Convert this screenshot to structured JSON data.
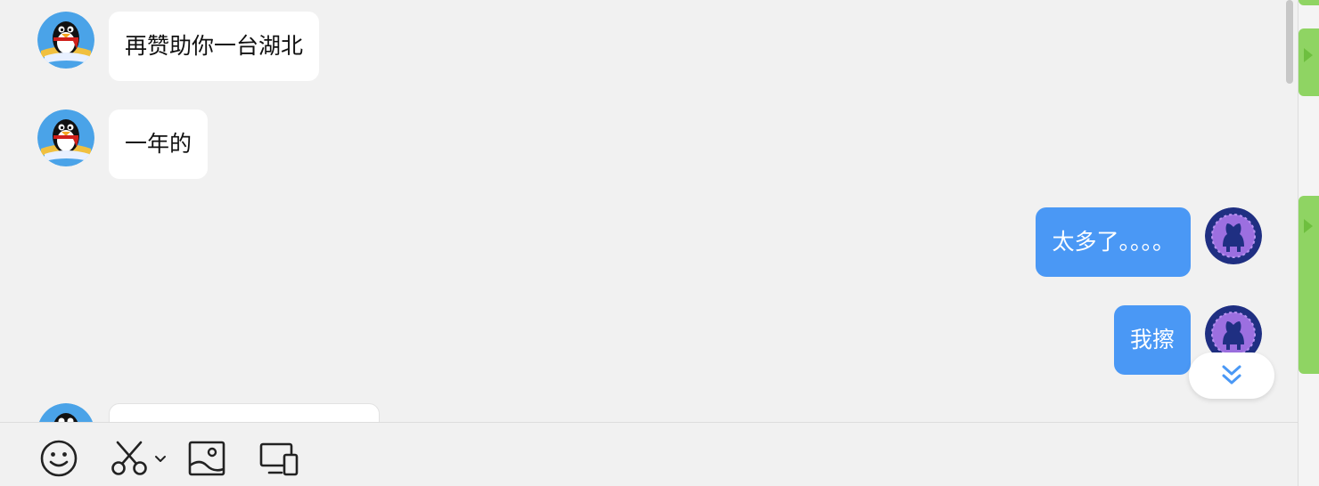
{
  "messages": [
    {
      "side": "left",
      "text": "再赞助你一台湖北",
      "avatar": "qq-penguin-avatar"
    },
    {
      "side": "left",
      "text": "一年的",
      "avatar": "qq-penguin-avatar"
    },
    {
      "side": "right",
      "text": "太多了。。。。",
      "avatar": "github-octocat-avatar"
    },
    {
      "side": "right",
      "text": "我擦",
      "avatar": "github-octocat-avatar"
    },
    {
      "side": "left",
      "text": "",
      "avatar": "qq-penguin-avatar"
    }
  ],
  "toolbar": {
    "items": [
      {
        "name": "emoji-button",
        "icon": "smiley-icon"
      },
      {
        "name": "screenshot-button",
        "icon": "scissors-icon",
        "dropdown": "chevron-down-icon"
      },
      {
        "name": "image-button",
        "icon": "image-icon"
      },
      {
        "name": "screen-share-button",
        "icon": "devices-icon"
      }
    ]
  },
  "jump_to_bottom": {
    "icon": "double-chevron-down-icon",
    "color": "#4a98f5"
  },
  "colors": {
    "background": "#f1f1f1",
    "outgoing_bubble": "#4a98f5",
    "incoming_bubble": "#ffffff",
    "side_tab": "#8fd463"
  }
}
